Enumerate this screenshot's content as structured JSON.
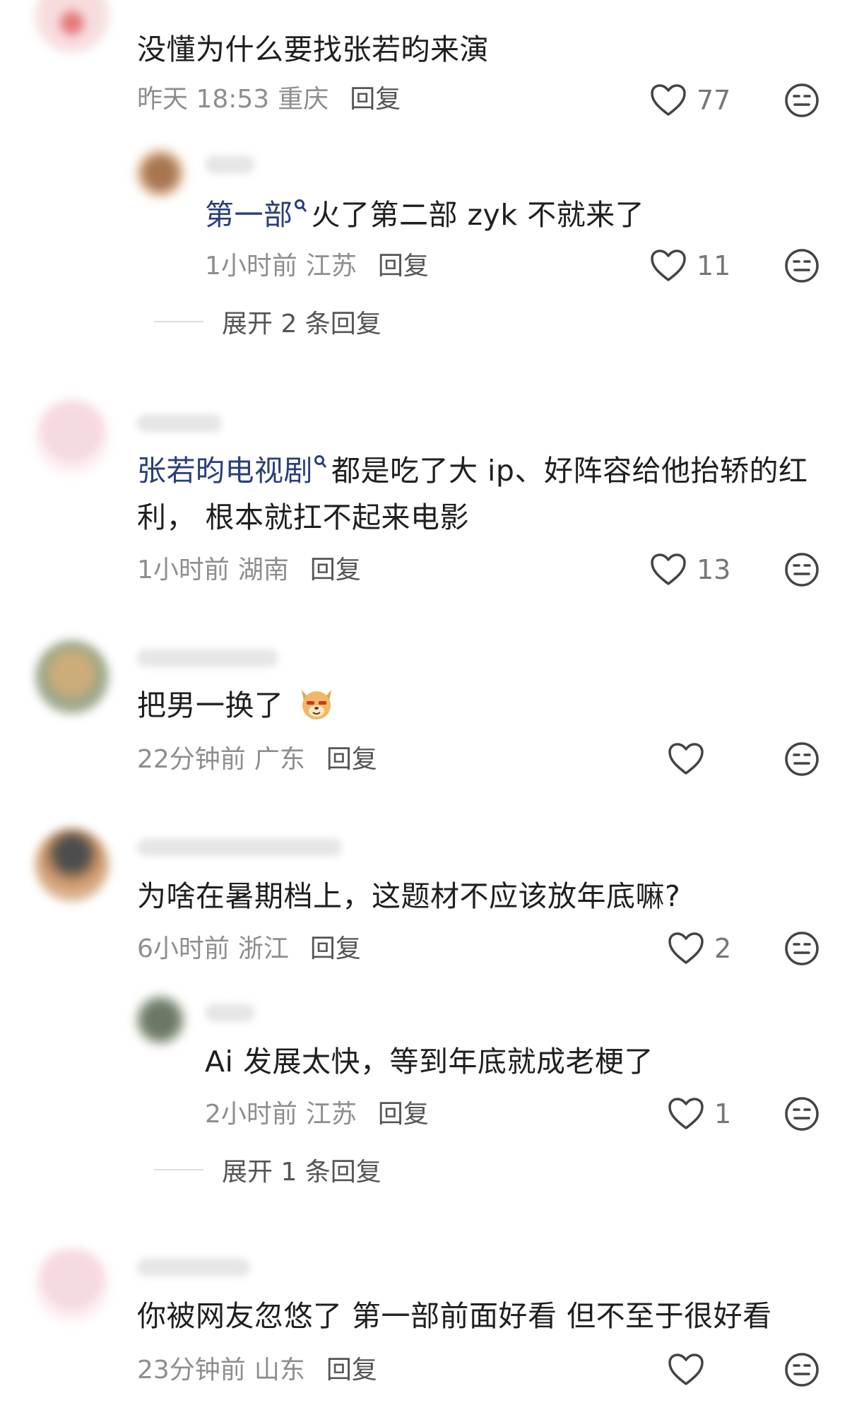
{
  "comments": [
    {
      "content": "没懂为什么要找张若昀来演",
      "time": "昨天 18:53",
      "location": "重庆",
      "reply_label": "回复",
      "likes": "77",
      "replies": [
        {
          "mention": "第一部",
          "content": "火了第二部 zyk 不就来了",
          "time": "1小时前",
          "location": "江苏",
          "reply_label": "回复",
          "likes": "11"
        }
      ],
      "expand_label": "展开 2 条回复"
    },
    {
      "mention": "张若昀电视剧",
      "content_line1": "都是吃了大 ip、好阵容给他抬轿的红",
      "content_line2": "利， 根本就扛不起来电影",
      "time": "1小时前",
      "location": "湖南",
      "reply_label": "回复",
      "likes": "13"
    },
    {
      "content": "把男一换了",
      "emoji": "dog-emoji",
      "time": "22分钟前",
      "location": "广东",
      "reply_label": "回复",
      "likes": ""
    },
    {
      "content": "为啥在暑期档上，这题材不应该放年底嘛?",
      "time": "6小时前",
      "location": "浙江",
      "reply_label": "回复",
      "likes": "2",
      "replies": [
        {
          "content": "Ai 发展太快，等到年底就成老梗了",
          "time": "2小时前",
          "location": "江苏",
          "reply_label": "回复",
          "likes": "1"
        }
      ],
      "expand_label": "展开 1 条回复"
    },
    {
      "content": "你被网友忽悠了 第一部前面好看 但不至于很好看",
      "time": "23分钟前",
      "location": "山东",
      "reply_label": "回复",
      "likes": ""
    }
  ],
  "icons": {
    "like": "heart-outline-icon",
    "react": "neutral-face-icon"
  },
  "colors": {
    "mention": "#2a3f7a",
    "meta": "#8e8e8e",
    "text": "#1f1f1f"
  }
}
